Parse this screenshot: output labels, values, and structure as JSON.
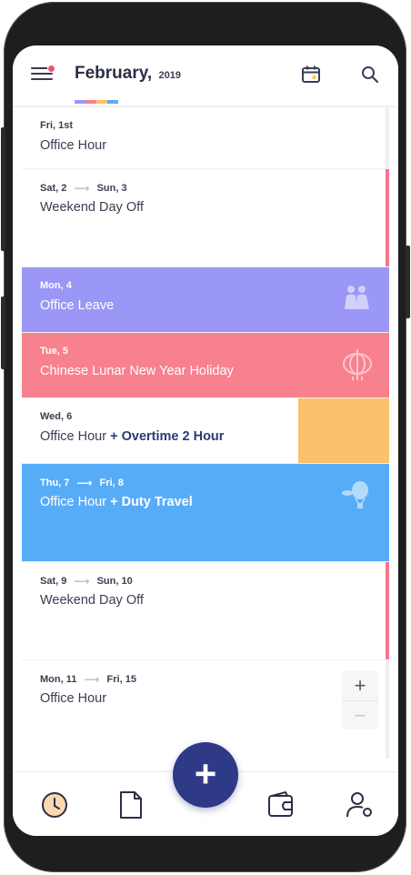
{
  "header": {
    "month": "February,",
    "year": "2019",
    "underline_colors": [
      "#9a97f6",
      "#f8818e",
      "#fcc16d",
      "#57acf8"
    ]
  },
  "events": [
    {
      "date_start": "Fri, 1st",
      "date_end": "",
      "label": "Office Hour",
      "extra": "",
      "style": "white"
    },
    {
      "date_start": "Sat, 2",
      "date_end": "Sun, 3",
      "label": "Weekend Day Off",
      "extra": "",
      "style": "white-accent"
    },
    {
      "date_start": "Mon, 4",
      "date_end": "",
      "label": "Office Leave",
      "extra": "",
      "style": "purple",
      "icon": "people-icon"
    },
    {
      "date_start": "Tue, 5",
      "date_end": "",
      "label": "Chinese Lunar New Year Holiday",
      "extra": "",
      "style": "red",
      "icon": "lantern-icon"
    },
    {
      "date_start": "Wed, 6",
      "date_end": "",
      "label": "Office Hour",
      "extra": "+ Overtime 2 Hour",
      "style": "white-orange"
    },
    {
      "date_start": "Thu, 7",
      "date_end": "Fri, 8",
      "label": "Office Hour",
      "extra": "+ Duty Travel",
      "style": "blue",
      "icon": "hot-air-balloon-icon"
    },
    {
      "date_start": "Sat, 9",
      "date_end": "Sun, 10",
      "label": "Weekend Day Off",
      "extra": "",
      "style": "white-accent"
    },
    {
      "date_start": "Mon, 11",
      "date_end": "Fri, 15",
      "label": "Office Hour",
      "extra": "",
      "style": "white"
    }
  ],
  "zoom": {
    "plus": "+",
    "minus": "−"
  },
  "fab": {
    "label": "+"
  },
  "colors": {
    "accent_pink": "#f7768e",
    "navy": "#2e3a86",
    "purple": "#9a97f6",
    "red": "#f8818e",
    "orange": "#fcc16d",
    "blue": "#57acf8"
  },
  "bottom_nav": [
    "clock-icon",
    "document-icon",
    "wallet-icon",
    "user-settings-icon"
  ]
}
